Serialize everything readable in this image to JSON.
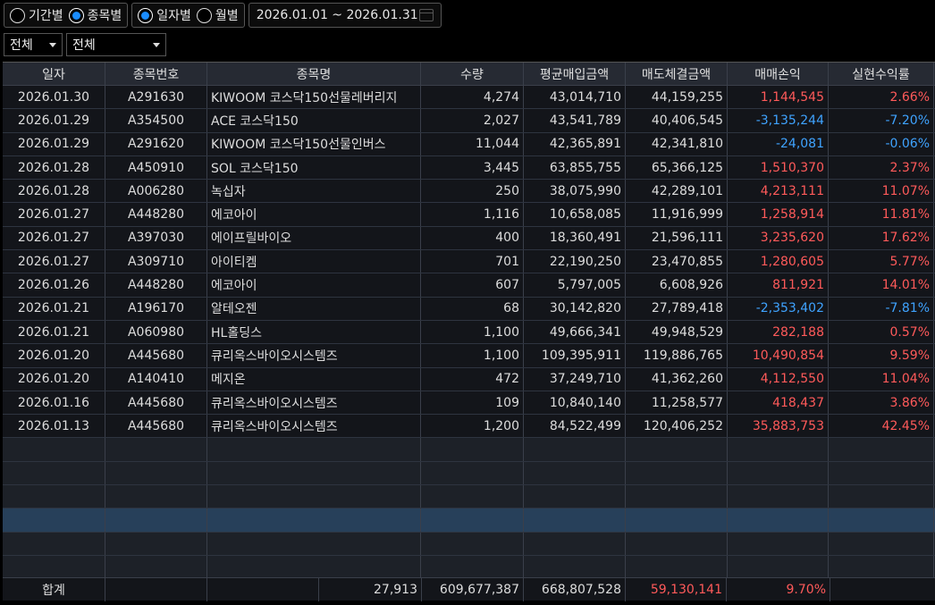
{
  "topbar": {
    "radio_group1": [
      {
        "label": "기간별",
        "selected": false
      },
      {
        "label": "종목별",
        "selected": true
      }
    ],
    "radio_group2": [
      {
        "label": "일자별",
        "selected": true
      },
      {
        "label": "월별",
        "selected": false
      }
    ],
    "date_range": "2026.01.01 ~ 2026.01.31"
  },
  "filters": {
    "filter1": "전체",
    "filter2": "전체"
  },
  "table": {
    "headers": [
      "일자",
      "종목번호",
      "종목명",
      "수량",
      "평균매입금액",
      "매도체결금액",
      "매매손익",
      "실현수익률"
    ],
    "rows": [
      [
        "2026.01.30",
        "A291630",
        "KIWOOM 코스닥150선물레버리지",
        "4,274",
        "43,014,710",
        "44,159,255",
        "1,144,545",
        "2.66%"
      ],
      [
        "2026.01.29",
        "A354500",
        "ACE 코스닥150",
        "2,027",
        "43,541,789",
        "40,406,545",
        "-3,135,244",
        "-7.20%"
      ],
      [
        "2026.01.29",
        "A291620",
        "KIWOOM 코스닥150선물인버스",
        "11,044",
        "42,365,891",
        "42,341,810",
        "-24,081",
        "-0.06%"
      ],
      [
        "2026.01.28",
        "A450910",
        "SOL 코스닥150",
        "3,445",
        "63,855,755",
        "65,366,125",
        "1,510,370",
        "2.37%"
      ],
      [
        "2026.01.28",
        "A006280",
        "녹십자",
        "250",
        "38,075,990",
        "42,289,101",
        "4,213,111",
        "11.07%"
      ],
      [
        "2026.01.27",
        "A448280",
        "에코아이",
        "1,116",
        "10,658,085",
        "11,916,999",
        "1,258,914",
        "11.81%"
      ],
      [
        "2026.01.27",
        "A397030",
        "에이프릴바이오",
        "400",
        "18,360,491",
        "21,596,111",
        "3,235,620",
        "17.62%"
      ],
      [
        "2026.01.27",
        "A309710",
        "아이티켐",
        "701",
        "22,190,250",
        "23,470,855",
        "1,280,605",
        "5.77%"
      ],
      [
        "2026.01.26",
        "A448280",
        "에코아이",
        "607",
        "5,797,005",
        "6,608,926",
        "811,921",
        "14.01%"
      ],
      [
        "2026.01.21",
        "A196170",
        "알테오젠",
        "68",
        "30,142,820",
        "27,789,418",
        "-2,353,402",
        "-7.81%"
      ],
      [
        "2026.01.21",
        "A060980",
        "HL홀딩스",
        "1,100",
        "49,666,341",
        "49,948,529",
        "282,188",
        "0.57%"
      ],
      [
        "2026.01.20",
        "A445680",
        "큐리옥스바이오시스템즈",
        "1,100",
        "109,395,911",
        "119,886,765",
        "10,490,854",
        "9.59%"
      ],
      [
        "2026.01.20",
        "A140410",
        "메지온",
        "472",
        "37,249,710",
        "41,362,260",
        "4,112,550",
        "11.04%"
      ],
      [
        "2026.01.16",
        "A445680",
        "큐리옥스바이오시스템즈",
        "109",
        "10,840,140",
        "11,258,577",
        "418,437",
        "3.86%"
      ],
      [
        "2026.01.13",
        "A445680",
        "큐리옥스바이오시스템즈",
        "1,200",
        "84,522,499",
        "120,406,252",
        "35,883,753",
        "42.45%"
      ]
    ],
    "row_signs": [
      1,
      -1,
      -1,
      1,
      1,
      1,
      1,
      1,
      1,
      -1,
      1,
      1,
      1,
      1,
      1
    ]
  },
  "total": {
    "label": "합계",
    "quantity": "27,913",
    "avg_buy": "609,677,387",
    "sell": "668,807,528",
    "pnl": "59,130,141",
    "rate": "9.70%"
  },
  "colors": {
    "profit": "#ff5a5a",
    "loss": "#3fa3ff",
    "selected_row": "#27405a"
  }
}
